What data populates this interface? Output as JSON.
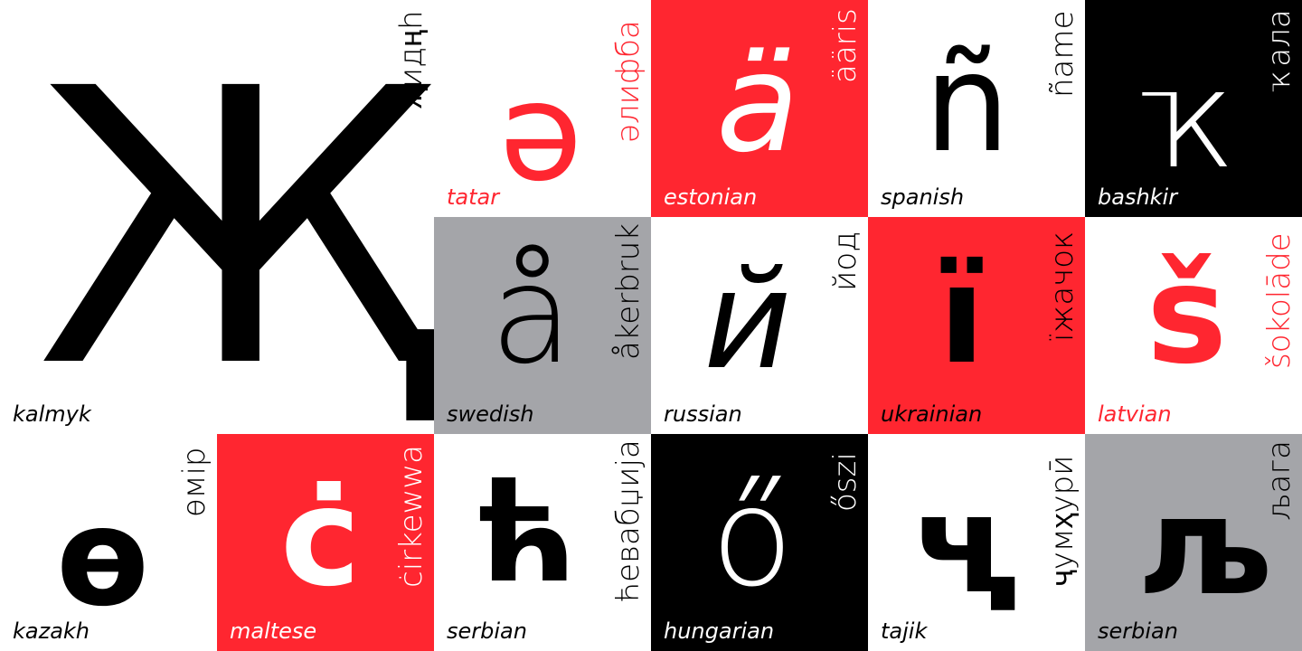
{
  "cells": {
    "kalmyk": {
      "glyph": "Җ",
      "word": "җидңһ",
      "lang": "kalmyk"
    },
    "tatar": {
      "glyph": "ә",
      "word": "әлифба",
      "lang": "tatar"
    },
    "estonian": {
      "glyph": "ä",
      "word": "ääris",
      "lang": "estonian"
    },
    "spanish": {
      "glyph": "ñ",
      "word": "ñame",
      "lang": "spanish"
    },
    "bashkir": {
      "glyph": "ҡ",
      "word": "ҡала",
      "lang": "bashkir"
    },
    "swedish": {
      "glyph": "å",
      "word": "åkerbruk",
      "lang": "swedish"
    },
    "russian": {
      "glyph": "й",
      "word": "йод",
      "lang": "russian"
    },
    "ukrainian": {
      "glyph": "ї",
      "word": "їжачок",
      "lang": "ukrainian"
    },
    "latvian": {
      "glyph": "š",
      "word": "šokolāde",
      "lang": "latvian"
    },
    "kazakh": {
      "glyph": "ө",
      "word": "өмір",
      "lang": "kazakh"
    },
    "maltese": {
      "glyph": "ċ",
      "word": "ċirkewwa",
      "lang": "maltese"
    },
    "serbian_h": {
      "glyph": "ћ",
      "word": "ћевабџија",
      "lang": "serbian"
    },
    "hungarian": {
      "glyph": "ő",
      "word": "őszi",
      "lang": "hungarian"
    },
    "tajik": {
      "glyph": "ҷ",
      "word": "ҷумҳурӣ",
      "lang": "tajik"
    },
    "serbian_lj": {
      "glyph": "љ",
      "word": "љага",
      "lang": "serbian"
    }
  },
  "colors": {
    "red": "#ff2630",
    "black": "#000000",
    "gray": "#a4a5a9",
    "white": "#ffffff"
  }
}
